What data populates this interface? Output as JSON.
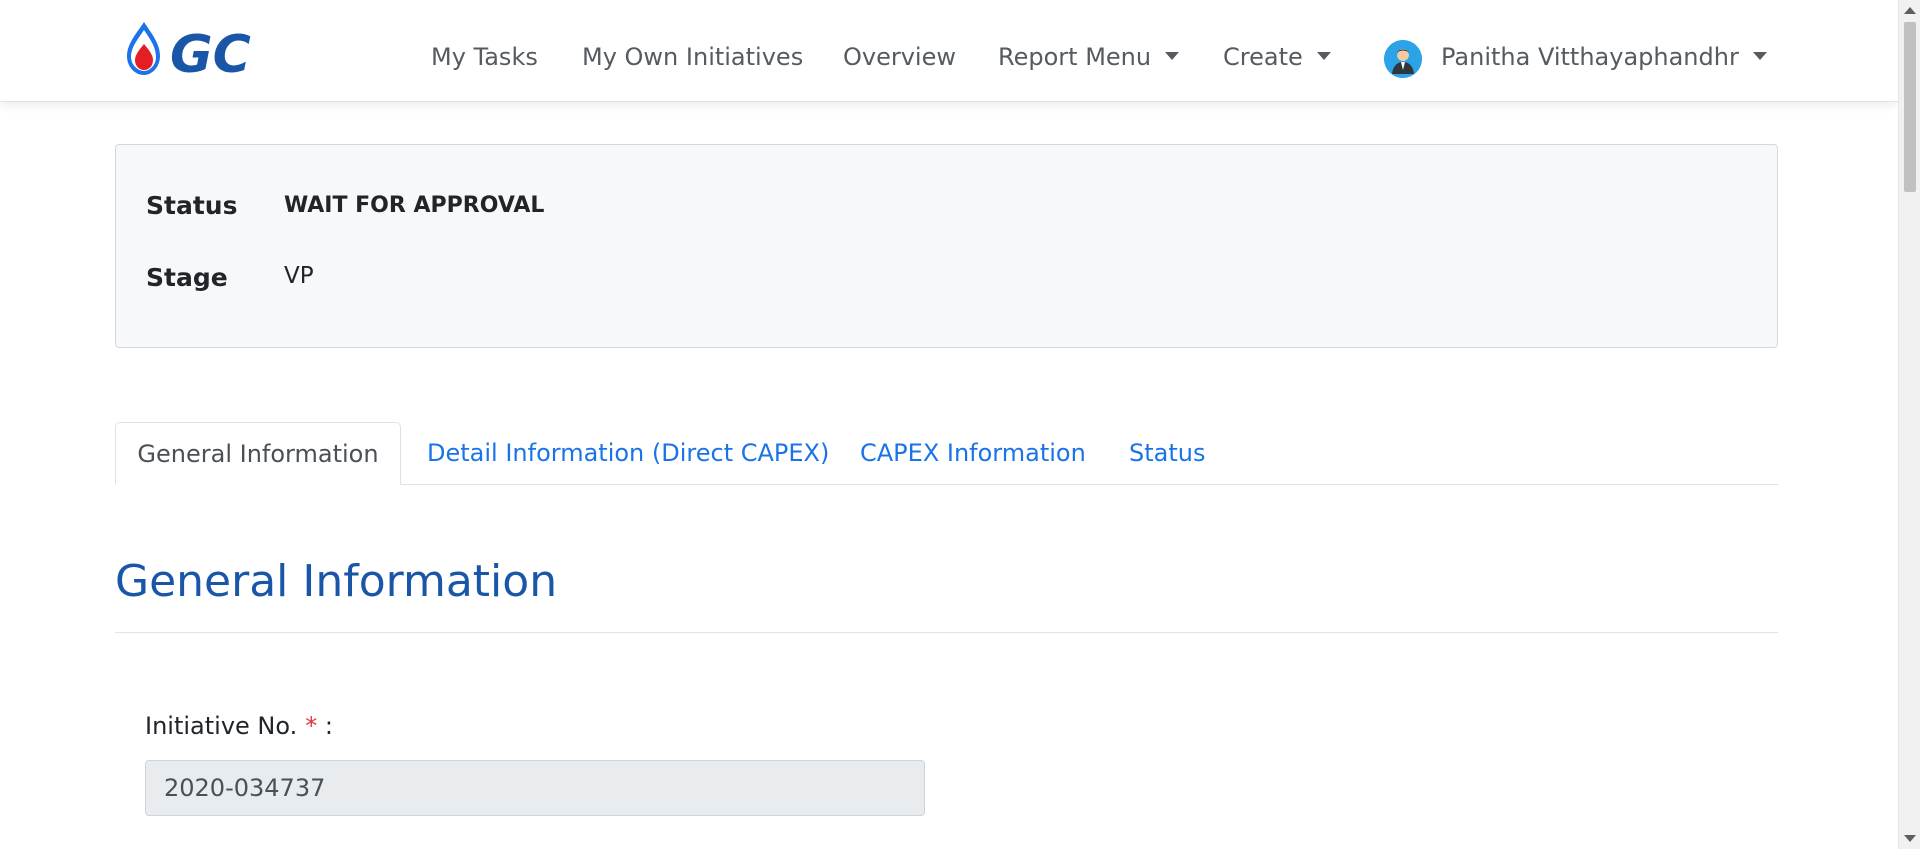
{
  "header": {
    "logo_text": "GC",
    "nav": [
      {
        "label": "My Tasks"
      },
      {
        "label": "My Own Initiatives"
      },
      {
        "label": "Overview"
      },
      {
        "label": "Report Menu"
      },
      {
        "label": "Create"
      }
    ],
    "user_name": "Panitha Vitthayaphandhr"
  },
  "status_card": {
    "status_label": "Status",
    "status_value": "WAIT FOR APPROVAL",
    "stage_label": "Stage",
    "stage_value": "VP"
  },
  "tabs": [
    {
      "label": "General Information",
      "active": true
    },
    {
      "label": "Detail Information (Direct CAPEX)"
    },
    {
      "label": "CAPEX Information"
    },
    {
      "label": "Status"
    }
  ],
  "section": {
    "title": "General Information",
    "field_label": "Initiative No.",
    "required_mark": "*",
    "label_colon": ":",
    "field_value": "2020-034737"
  },
  "colors": {
    "brand_blue": "#1a56a8",
    "link_blue": "#1a73e8",
    "required_red": "#dc3545",
    "drop_red": "#e31e24"
  },
  "icons": {
    "avatar": "user-avatar-icon",
    "dropdown": "caret-down-icon"
  }
}
